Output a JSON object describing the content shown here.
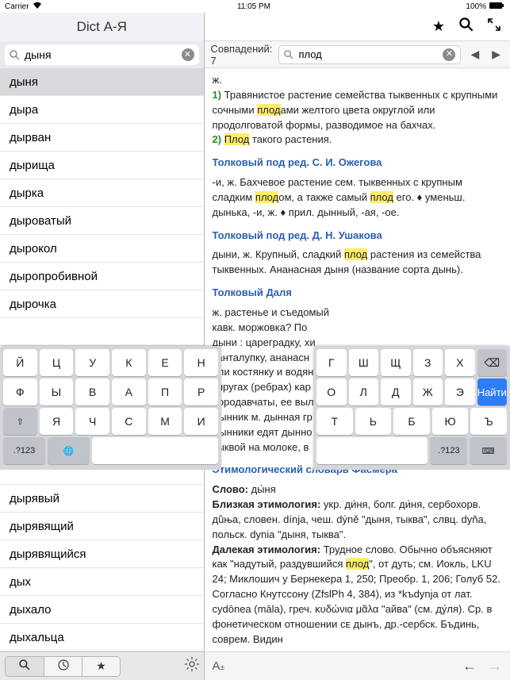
{
  "status": {
    "carrier": "Carrier",
    "wifi": "✶",
    "time": "11:05 PM",
    "battery": "100%"
  },
  "left": {
    "title": "Dict А-Я",
    "search_value": "дыня",
    "words": [
      "дыня",
      "дыра",
      "дырван",
      "дырища",
      "дырка",
      "дыроватый",
      "дырокол",
      "дыропробивной",
      "дырочка",
      "",
      "",
      "",
      "",
      "",
      "",
      "дырявый",
      "дырявящий",
      "дырявящийся",
      "дых",
      "дыхало",
      "дыхальца"
    ]
  },
  "right": {
    "match_label": "Совпадений: 7",
    "find_value": "плод",
    "article": {
      "p0": "ж.",
      "n1": "1)",
      "t1a": " Травянистое растение семейства тыквенных с крупными сочными ",
      "t1h": "плод",
      "t1b": "ами желтого цвета округлой или продолговатой формы, разводимое на бахчах.",
      "n2": "2)",
      "t2h": "Плод",
      "t2b": " такого растения.",
      "d1": "Толковый под ред. С. И. Ожегова",
      "p1a": "-и, ж. Бахчевое растение сем. тыквенных с крупным сладким ",
      "p1h1": "плод",
      "p1b": "ом, а также самый ",
      "p1h2": "плод",
      "p1c": " его. ♦ уменьш. дынька, -и, ж. ♦ прил. дынный, -ая, -ое.",
      "d2": "Толковый под ред. Д. Н. Ушакова",
      "p2a": "дыни, ж. Крупный, сладкий ",
      "p2h": "плод",
      "p2b": " растения из семейства тыквенных. Ананасная дыня (название сорта дынь).",
      "d3": "Толковый Даля",
      "p3": "ж. растенье и съедомый\nкавк. моржовка? По\nдыни : цареградку, хи\nканталупку, ананасн\nили костянку и водян\nупругах (ребрах) кар\nбородавчаты, ее выл\nДынник м. дынная гр\nДынники едят дынно\nтыквой на молоке, в",
      "d4": "Этимологический словарь Фасмера",
      "p4a": "Слово:",
      "p4av": " ды́ня",
      "p4b": "Близкая этимология:",
      "p4bv": " укр. ди́ня, болг. ди́ня, сербохорв. дȕња, словен. dínja, чеш. dýně \"дыня, тыква\", слвц. dyňa, польск. dynia \"дыня, тыква\".",
      "p4c": "Далекая этимология:",
      "p4cv1": " Трудное слово. Обычно объясняют как \"надутый, раздувшийся ",
      "p4ch": "плод",
      "p4cv2": "\", от дуть; см. Иокль, LKU 24; Миклошич у Бернекера 1, 250; Преобр. 1, 206; Голуб 52. Согласно Кнутссону (ZfslPh 4, 384), из *kъdynja от лат. cydōnea (māla), греч. κυδώνια μᾶλα \"айва\" (см. ду́ля). Ср. в фонетическом отношении ᴄᴇ дынъ, др.-сербск. Бъдинь, соврем. Видин"
    }
  },
  "kb_left": {
    "r1": [
      "Й",
      "Ц",
      "У",
      "К",
      "Е",
      "Н"
    ],
    "r2": [
      "Ф",
      "Ы",
      "В",
      "А",
      "П",
      "Р"
    ],
    "r3": [
      "Я",
      "Ч",
      "С",
      "М",
      "И"
    ],
    "fn123": ".?123",
    "globe": "🌐"
  },
  "kb_right": {
    "r1": [
      "Г",
      "Ш",
      "Щ",
      "З",
      "Х",
      "⌫"
    ],
    "r2": [
      "О",
      "Л",
      "Д",
      "Ж",
      "Э",
      "Найти"
    ],
    "r3": [
      "Т",
      "Ь",
      "Б",
      "Ю",
      "Ъ"
    ],
    "fn123": ".?123",
    "kbicon": "⌨"
  }
}
